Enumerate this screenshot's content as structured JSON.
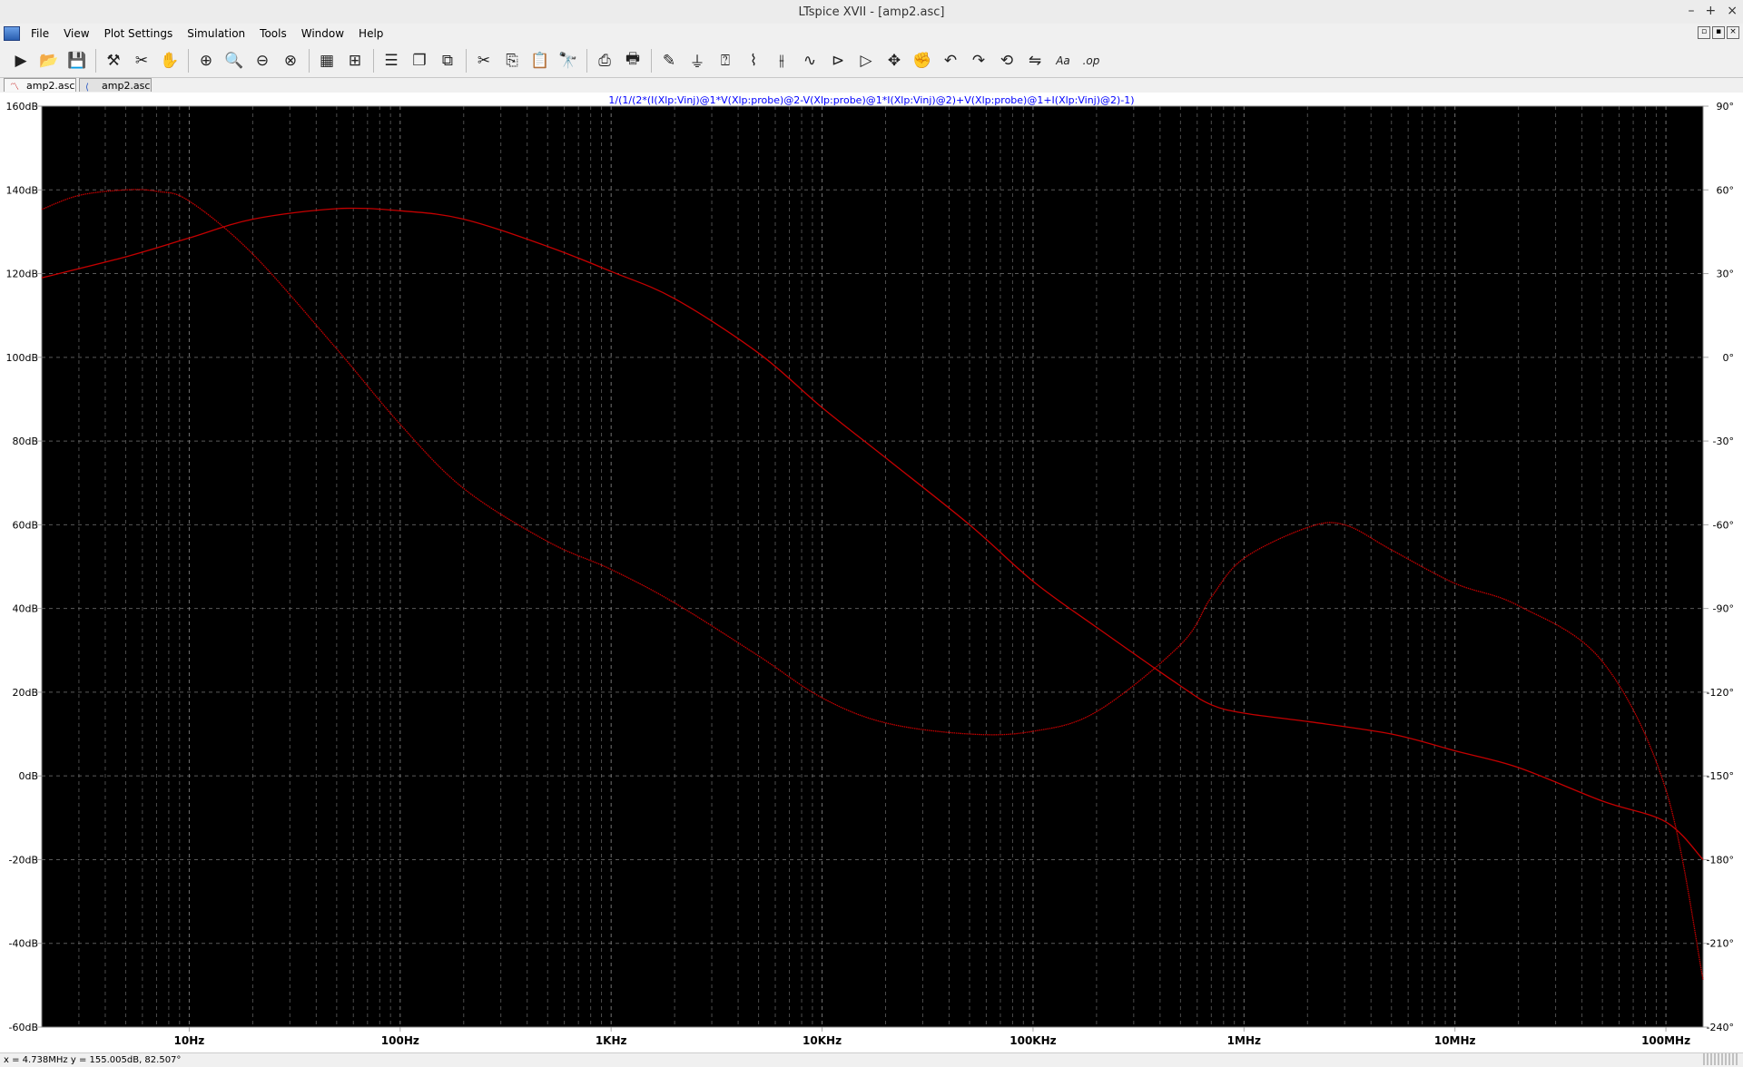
{
  "window": {
    "title": "LTspice XVII - [amp2.asc]",
    "controls": [
      "–",
      "+",
      "×"
    ]
  },
  "menu": [
    "File",
    "View",
    "Plot Settings",
    "Simulation",
    "Tools",
    "Window",
    "Help"
  ],
  "toolbar": [
    {
      "name": "run-icon",
      "glyph": "▶"
    },
    {
      "name": "open-icon",
      "glyph": "📂"
    },
    {
      "name": "save-icon",
      "glyph": "💾"
    },
    {
      "sep": true
    },
    {
      "name": "control-panel-icon",
      "glyph": "⚒"
    },
    {
      "name": "halt-icon",
      "glyph": "✂"
    },
    {
      "name": "pan-icon",
      "glyph": "✋"
    },
    {
      "sep": true
    },
    {
      "name": "zoom-in-icon",
      "glyph": "⊕"
    },
    {
      "name": "zoom-area-icon",
      "glyph": "🔍"
    },
    {
      "name": "zoom-out-icon",
      "glyph": "⊖"
    },
    {
      "name": "zoom-fit-icon",
      "glyph": "⊗"
    },
    {
      "sep": true
    },
    {
      "name": "autorange-icon",
      "glyph": "▦"
    },
    {
      "name": "plot-settings-icon",
      "glyph": "⊞"
    },
    {
      "sep": true
    },
    {
      "name": "tile-horizontal-icon",
      "glyph": "☰"
    },
    {
      "name": "cascade-icon",
      "glyph": "❐"
    },
    {
      "name": "tile-vertical-icon",
      "glyph": "⧉"
    },
    {
      "sep": true
    },
    {
      "name": "cut-icon",
      "glyph": "✂"
    },
    {
      "name": "copy-icon",
      "glyph": "⎘"
    },
    {
      "name": "paste-icon",
      "glyph": "📋"
    },
    {
      "name": "find-icon",
      "glyph": "🔭"
    },
    {
      "sep": true
    },
    {
      "name": "print-preview-icon",
      "glyph": "⎙"
    },
    {
      "name": "print-icon",
      "glyph": "🖶"
    },
    {
      "sep": true
    },
    {
      "name": "wire-icon",
      "glyph": "✎"
    },
    {
      "name": "ground-icon",
      "glyph": "⏚"
    },
    {
      "name": "label-icon",
      "glyph": "⍰"
    },
    {
      "name": "resistor-icon",
      "glyph": "⌇"
    },
    {
      "name": "capacitor-icon",
      "glyph": "⫲"
    },
    {
      "name": "inductor-icon",
      "glyph": "∿"
    },
    {
      "name": "diode-icon",
      "glyph": "⊳"
    },
    {
      "name": "component-icon",
      "glyph": "▷"
    },
    {
      "name": "move-icon",
      "glyph": "✥"
    },
    {
      "name": "drag-icon",
      "glyph": "✊"
    },
    {
      "name": "undo-icon",
      "glyph": "↶"
    },
    {
      "name": "redo-icon",
      "glyph": "↷"
    },
    {
      "name": "rotate-icon",
      "glyph": "⟲"
    },
    {
      "name": "mirror-icon",
      "glyph": "⇋"
    },
    {
      "name": "text-icon",
      "glyph": "Aa"
    },
    {
      "name": "spice-directive-icon",
      "glyph": ".op"
    }
  ],
  "tabs": [
    {
      "label": "amp2.asc",
      "icon": "waveform-icon"
    },
    {
      "label": "amp2.asc",
      "icon": "schematic-icon"
    }
  ],
  "plot": {
    "trace_expression": "1/(1/(2*(I(Xlp:Vinj)@1*V(Xlp:probe)@2-V(Xlp:probe)@1*I(Xlp:Vinj)@2)+V(Xlp:probe)@1+I(Xlp:Vinj)@2)-1)",
    "trace_color": "#0000ff",
    "background": "#000000",
    "grid_color": "#808080",
    "curve_color": "#c40000"
  },
  "chart_data": {
    "type": "line",
    "title": "",
    "xlabel": "",
    "ylabel": "",
    "xscale": "log",
    "xlim": [
      2,
      150000000
    ],
    "ylim": [
      -60,
      160
    ],
    "y2lim": [
      -240,
      90
    ],
    "grid": true,
    "x_tick_labels": [
      "10Hz",
      "100Hz",
      "1KHz",
      "10KHz",
      "100KHz",
      "1MHz",
      "10MHz",
      "100MHz"
    ],
    "y_tick_labels": [
      "160dB",
      "140dB",
      "120dB",
      "100dB",
      "80dB",
      "60dB",
      "40dB",
      "20dB",
      "0dB",
      "-20dB",
      "-40dB",
      "-60dB"
    ],
    "y2_tick_labels": [
      "90°",
      "60°",
      "30°",
      "0°",
      "-30°",
      "-60°",
      "-90°",
      "-120°",
      "-150°",
      "-180°",
      "-210°",
      "-240°"
    ],
    "series": [
      {
        "axis": "left",
        "unit": "dB",
        "x": [
          2,
          5,
          10,
          20,
          50,
          100,
          200,
          500,
          1000,
          2000,
          5000,
          10000,
          20000,
          50000,
          100000,
          200000,
          500000,
          700000,
          1000000,
          2000000,
          5000000,
          10000000,
          20000000,
          50000000,
          100000000,
          150000000
        ],
        "y": [
          119,
          124,
          128.5,
          133,
          135.5,
          135,
          133,
          126.5,
          120.5,
          114,
          101,
          88,
          76,
          60,
          46.5,
          35.5,
          21.5,
          17,
          15,
          13,
          10,
          6,
          2,
          -6,
          -11,
          -20
        ]
      },
      {
        "axis": "right",
        "unit": "°",
        "x": [
          2,
          3,
          5,
          7,
          10,
          20,
          50,
          100,
          200,
          500,
          1000,
          2000,
          5000,
          10000,
          20000,
          50000,
          100000,
          200000,
          500000,
          700000,
          1000000,
          2000000,
          3000000,
          5000000,
          10000000,
          20000000,
          50000000,
          100000000,
          150000000
        ],
        "y": [
          53,
          58,
          60,
          59.5,
          56,
          37,
          3,
          -24,
          -47,
          -66,
          -76,
          -88,
          -107,
          -122,
          -131,
          -135,
          -134,
          -127,
          -103,
          -86,
          -72,
          -61,
          -60,
          -69,
          -81,
          -89,
          -109,
          -155,
          -223
        ]
      }
    ]
  },
  "status": {
    "cursor_readout": "x = 4.738MHz    y = 155.005dB, 82.507°"
  }
}
